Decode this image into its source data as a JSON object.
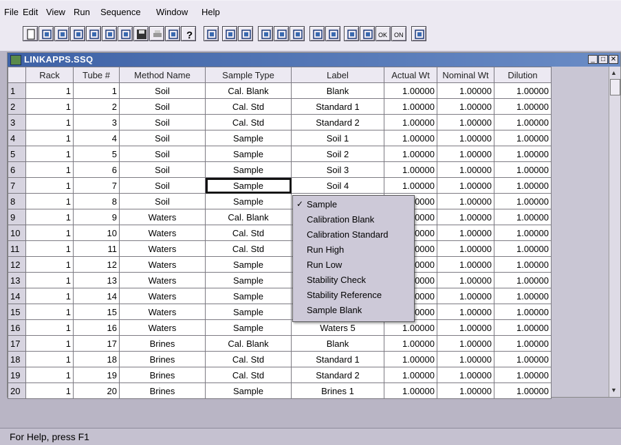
{
  "menu": [
    "File",
    "Edit",
    "View",
    "Run",
    "Sequence",
    "Window",
    "Help"
  ],
  "toolbar_icons": [
    "new-icon",
    "open-icon",
    "open-lib-icon",
    "open-seq-icon",
    "edit-seq-icon",
    "run-seq-icon",
    "open-method-icon",
    "save-icon",
    "print-icon",
    "print-preview-icon",
    "help-icon",
    "tuning-icon",
    "lamp-icon",
    "fluid-icon",
    "calibrate-icon",
    "run-sample-icon",
    "run-person-icon",
    "results-icon",
    "report-icon",
    "beep-low-icon",
    "beep-normal-icon",
    "ok-icon",
    "on-icon",
    "pump-icon"
  ],
  "window": {
    "title": "LINKAPPS.SSQ",
    "min": "_",
    "max": "□",
    "close": "✕"
  },
  "columns": [
    "",
    "Rack",
    "Tube #",
    "Method Name",
    "Sample Type",
    "Label",
    "Actual Wt",
    "Nominal Wt",
    "Dilution"
  ],
  "rows": [
    [
      "1",
      "1",
      "1",
      "Soil",
      "Cal. Blank",
      "Blank",
      "1.00000",
      "1.00000",
      "1.00000"
    ],
    [
      "2",
      "1",
      "2",
      "Soil",
      "Cal. Std",
      "Standard 1",
      "1.00000",
      "1.00000",
      "1.00000"
    ],
    [
      "3",
      "1",
      "3",
      "Soil",
      "Cal. Std",
      "Standard 2",
      "1.00000",
      "1.00000",
      "1.00000"
    ],
    [
      "4",
      "1",
      "4",
      "Soil",
      "Sample",
      "Soil 1",
      "1.00000",
      "1.00000",
      "1.00000"
    ],
    [
      "5",
      "1",
      "5",
      "Soil",
      "Sample",
      "Soil 2",
      "1.00000",
      "1.00000",
      "1.00000"
    ],
    [
      "6",
      "1",
      "6",
      "Soil",
      "Sample",
      "Soil 3",
      "1.00000",
      "1.00000",
      "1.00000"
    ],
    [
      "7",
      "1",
      "7",
      "Soil",
      "Sample",
      "Soil 4",
      "1.00000",
      "1.00000",
      "1.00000"
    ],
    [
      "8",
      "1",
      "8",
      "Soil",
      "Sample",
      "",
      "0000",
      "1.00000",
      "1.00000"
    ],
    [
      "9",
      "1",
      "9",
      "Waters",
      "Cal. Blank",
      "",
      "0000",
      "1.00000",
      "1.00000"
    ],
    [
      "10",
      "1",
      "10",
      "Waters",
      "Cal. Std",
      "",
      "0000",
      "1.00000",
      "1.00000"
    ],
    [
      "11",
      "1",
      "11",
      "Waters",
      "Cal. Std",
      "",
      "0000",
      "1.00000",
      "1.00000"
    ],
    [
      "12",
      "1",
      "12",
      "Waters",
      "Sample",
      "",
      "0000",
      "1.00000",
      "1.00000"
    ],
    [
      "13",
      "1",
      "13",
      "Waters",
      "Sample",
      "",
      "0000",
      "1.00000",
      "1.00000"
    ],
    [
      "14",
      "1",
      "14",
      "Waters",
      "Sample",
      "",
      "0000",
      "1.00000",
      "1.00000"
    ],
    [
      "15",
      "1",
      "15",
      "Waters",
      "Sample",
      "",
      "0000",
      "1.00000",
      "1.00000"
    ],
    [
      "16",
      "1",
      "16",
      "Waters",
      "Sample",
      "Waters 5",
      "1.00000",
      "1.00000",
      "1.00000"
    ],
    [
      "17",
      "1",
      "17",
      "Brines",
      "Cal. Blank",
      "Blank",
      "1.00000",
      "1.00000",
      "1.00000"
    ],
    [
      "18",
      "1",
      "18",
      "Brines",
      "Cal. Std",
      "Standard 1",
      "1.00000",
      "1.00000",
      "1.00000"
    ],
    [
      "19",
      "1",
      "19",
      "Brines",
      "Cal. Std",
      "Standard 2",
      "1.00000",
      "1.00000",
      "1.00000"
    ],
    [
      "20",
      "1",
      "20",
      "Brines",
      "Sample",
      "Brines 1",
      "1.00000",
      "1.00000",
      "1.00000"
    ]
  ],
  "selected_row": 7,
  "context_menu": {
    "checked": "✓",
    "items": [
      "Sample",
      "Calibration Blank",
      "Calibration Standard",
      "Run High",
      "Run Low",
      "Stability Check",
      "Stability Reference",
      "Sample Blank"
    ]
  },
  "status": "For Help, press F1"
}
